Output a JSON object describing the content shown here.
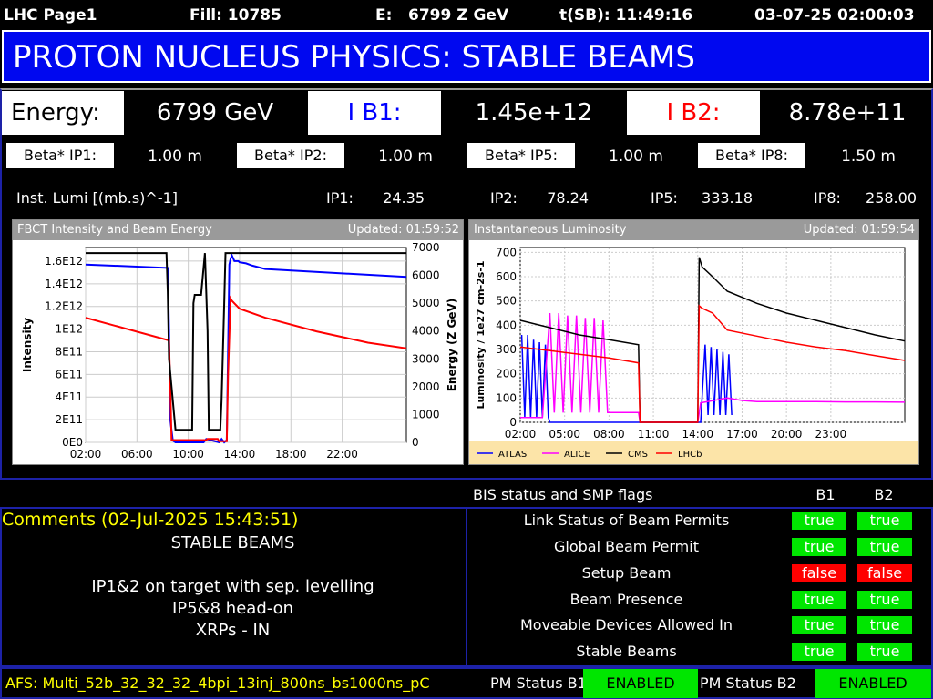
{
  "header": {
    "page": "LHC Page1",
    "fill": "Fill: 10785",
    "energy_label": "E:",
    "energy": "6799 Z GeV",
    "tsb": "t(SB): 11:49:16",
    "datetime": "03-07-25 02:00:03"
  },
  "mode": "PROTON NUCLEUS PHYSICS: STABLE BEAMS",
  "beam": {
    "energy_label": "Energy:",
    "energy_value": "6799 GeV",
    "ib1_label": "I B1:",
    "ib1_value": "1.45e+12",
    "ib2_label": "I B2:",
    "ib2_value": "8.78e+11"
  },
  "beta": [
    {
      "label": "Beta* IP1:",
      "value": "1.00 m"
    },
    {
      "label": "Beta* IP2:",
      "value": "1.00 m"
    },
    {
      "label": "Beta* IP5:",
      "value": "1.00 m"
    },
    {
      "label": "Beta* IP8:",
      "value": "1.50 m"
    }
  ],
  "lumi": {
    "label": "Inst. Lumi [(mb.s)^-1]",
    "ip1_label": "IP1:",
    "ip1": "24.35",
    "ip2_label": "IP2:",
    "ip2": "78.24",
    "ip5_label": "IP5:",
    "ip5": "333.18",
    "ip8_label": "IP8:",
    "ip8": "258.00"
  },
  "colors": {
    "mode_bg": "#0008f0",
    "ib1": "#0000ff",
    "ib2": "#ff0000",
    "flag_true": "#00e600",
    "flag_false": "#ff0000",
    "comment": "#ffff00"
  },
  "chart_data": [
    {
      "type": "line",
      "title": "FBCT Intensity and Beam Energy",
      "updated": "Updated: 01:59:52",
      "xlabel": "",
      "ylabel": "Intensity",
      "y2label": "Energy (Z GeV)",
      "x_ticks": [
        "02:00",
        "06:00",
        "10:00",
        "14:00",
        "18:00",
        "22:00"
      ],
      "y_ticks": [
        "0E0",
        "2E11",
        "4E11",
        "6E11",
        "8E11",
        "1E12",
        "1.2E12",
        "1.4E12",
        "1.6E12"
      ],
      "y2_ticks": [
        "0",
        "1000",
        "2000",
        "3000",
        "4000",
        "5000",
        "6000",
        "7000"
      ],
      "ylim": [
        0,
        1720000000000.0
      ],
      "y2lim": [
        0,
        7000
      ],
      "xlim": [
        0,
        25
      ],
      "series": [
        {
          "color": "#0000ff",
          "axis": "y",
          "x": [
            0,
            6.4,
            6.5,
            6.6,
            6.8,
            7.0,
            7.2,
            9.2,
            9.4,
            10.4,
            10.6,
            10.8,
            11.0,
            11.2,
            11.3,
            11.4,
            11.6,
            11.9,
            12.0,
            12.5,
            13.0,
            14.0,
            25
          ],
          "y": [
            1570000000000.0,
            1540000000000.0,
            1000000000000.0,
            200000000000.0,
            15000000000.0,
            0,
            0,
            0,
            30000000000.0,
            0,
            30000000000.0,
            0,
            20000000000.0,
            1570000000000.0,
            1620000000000.0,
            1650000000000.0,
            1600000000000.0,
            1600000000000.0,
            1590000000000.0,
            1580000000000.0,
            1560000000000.0,
            1530000000000.0,
            1460000000000.0
          ]
        },
        {
          "color": "#ff0000",
          "axis": "y",
          "x": [
            0,
            6.5,
            6.6,
            6.7,
            9.4,
            9.5,
            10.3,
            10.4,
            11.0,
            11.1,
            11.3,
            11.4,
            12.0,
            14.0,
            18.0,
            22.0,
            25
          ],
          "y": [
            1100000000000.0,
            900000000000.0,
            500000000000.0,
            20000000000.0,
            20000000000.0,
            30000000000.0,
            30000000000.0,
            10000000000.0,
            10000000000.0,
            600000000000.0,
            1270000000000.0,
            1250000000000.0,
            1180000000000.0,
            1100000000000.0,
            980000000000.0,
            880000000000.0,
            830000000000.0
          ]
        },
        {
          "color": "#000000",
          "axis": "y2",
          "x": [
            0,
            6.3,
            6.4,
            6.5,
            7.0,
            8.3,
            8.4,
            8.5,
            8.6,
            9.0,
            9.3,
            9.5,
            9.6,
            10.5,
            10.6,
            10.8,
            10.9,
            11.2,
            11.3,
            11.6,
            25
          ],
          "y2": [
            6800,
            6800,
            5400,
            3000,
            450,
            450,
            5000,
            5300,
            5300,
            5300,
            6800,
            4000,
            450,
            450,
            1500,
            5000,
            6800,
            6800,
            6800,
            6800,
            6800
          ]
        }
      ]
    },
    {
      "type": "line",
      "title": "Instantaneous Luminosity",
      "updated": "Updated: 01:59:54",
      "xlabel": "",
      "ylabel": "Luminosity / 1e27 cm-2s-1",
      "x_ticks": [
        "02:00",
        "05:00",
        "08:00",
        "11:00",
        "14:00",
        "17:00",
        "20:00",
        "23:00"
      ],
      "y_ticks": [
        "0",
        "100",
        "200",
        "300",
        "400",
        "500",
        "600",
        "700"
      ],
      "ylim": [
        0,
        720
      ],
      "xlim": [
        0,
        26
      ],
      "legend_position": "bottom",
      "series": [
        {
          "name": "ATLAS",
          "color": "#0000ff",
          "x": [
            0.1,
            0.3,
            0.5,
            0.7,
            0.9,
            1.1,
            1.3,
            1.5,
            1.7,
            1.9,
            2.0,
            12.2,
            12.5,
            12.7,
            12.9,
            13.1,
            13.3,
            13.5,
            13.7,
            13.9,
            14.1,
            14.3
          ],
          "y": [
            360,
            20,
            360,
            20,
            340,
            20,
            330,
            20,
            320,
            20,
            0,
            0,
            320,
            30,
            310,
            30,
            300,
            30,
            290,
            30,
            280,
            30
          ]
        },
        {
          "name": "ALICE",
          "color": "#ff00ff",
          "x": [
            0,
            1.5,
            2.0,
            2.3,
            2.6,
            2.9,
            3.2,
            3.5,
            3.8,
            4.1,
            4.4,
            4.7,
            5.0,
            5.3,
            5.6,
            5.9,
            6.2,
            6.5,
            8.0,
            8.1,
            12.0,
            12.2,
            14.0,
            15.0,
            16.0,
            18.0,
            20.0,
            22.0,
            24.0,
            26.0
          ],
          "y": [
            20,
            20,
            450,
            40,
            450,
            40,
            440,
            40,
            440,
            40,
            430,
            40,
            430,
            40,
            420,
            40,
            40,
            40,
            40,
            0,
            0,
            80,
            100,
            90,
            85,
            85,
            85,
            84,
            84,
            83
          ]
        },
        {
          "name": "CMS",
          "color": "#000000",
          "x": [
            0,
            2.0,
            4.0,
            6.0,
            8.0,
            8.1,
            12.0,
            12.1,
            12.3,
            13.0,
            14.0,
            16.0,
            18.0,
            20.0,
            22.0,
            24.0,
            26.0
          ],
          "y": [
            420,
            390,
            360,
            340,
            320,
            0,
            0,
            680,
            640,
            600,
            540,
            490,
            450,
            420,
            390,
            360,
            335
          ]
        },
        {
          "name": "LHCb",
          "color": "#ff0000",
          "x": [
            0,
            2.0,
            4.0,
            6.0,
            8.0,
            8.1,
            12.0,
            12.1,
            12.3,
            13.0,
            14.0,
            16.0,
            18.0,
            20.0,
            22.0,
            24.0,
            26.0
          ],
          "y": [
            310,
            295,
            280,
            265,
            245,
            0,
            0,
            480,
            470,
            450,
            380,
            355,
            330,
            310,
            295,
            275,
            255
          ]
        }
      ]
    }
  ],
  "bis": {
    "title": "BIS status and SMP flags",
    "b1": "B1",
    "b2": "B2",
    "flags": [
      {
        "label": "Link Status of Beam Permits",
        "b1": "true",
        "b2": "true"
      },
      {
        "label": "Global Beam Permit",
        "b1": "true",
        "b2": "true"
      },
      {
        "label": "Setup Beam",
        "b1": "false",
        "b2": "false"
      },
      {
        "label": "Beam Presence",
        "b1": "true",
        "b2": "true"
      },
      {
        "label": "Moveable Devices Allowed In",
        "b1": "true",
        "b2": "true"
      },
      {
        "label": "Stable Beams",
        "b1": "true",
        "b2": "true"
      }
    ]
  },
  "comments": {
    "header": "Comments (02-Jul-2025 15:43:51)",
    "lines": [
      "STABLE BEAMS",
      "",
      "IP1&2 on target with sep. levelling",
      "IP5&8 head-on",
      "XRPs - IN"
    ]
  },
  "footer": {
    "afs": "AFS: Multi_52b_32_32_32_4bpi_13inj_800ns_bs1000ns_pC",
    "pm1_label": "PM Status B1",
    "pm1": "ENABLED",
    "pm2_label": "PM Status B2",
    "pm2": "ENABLED"
  }
}
